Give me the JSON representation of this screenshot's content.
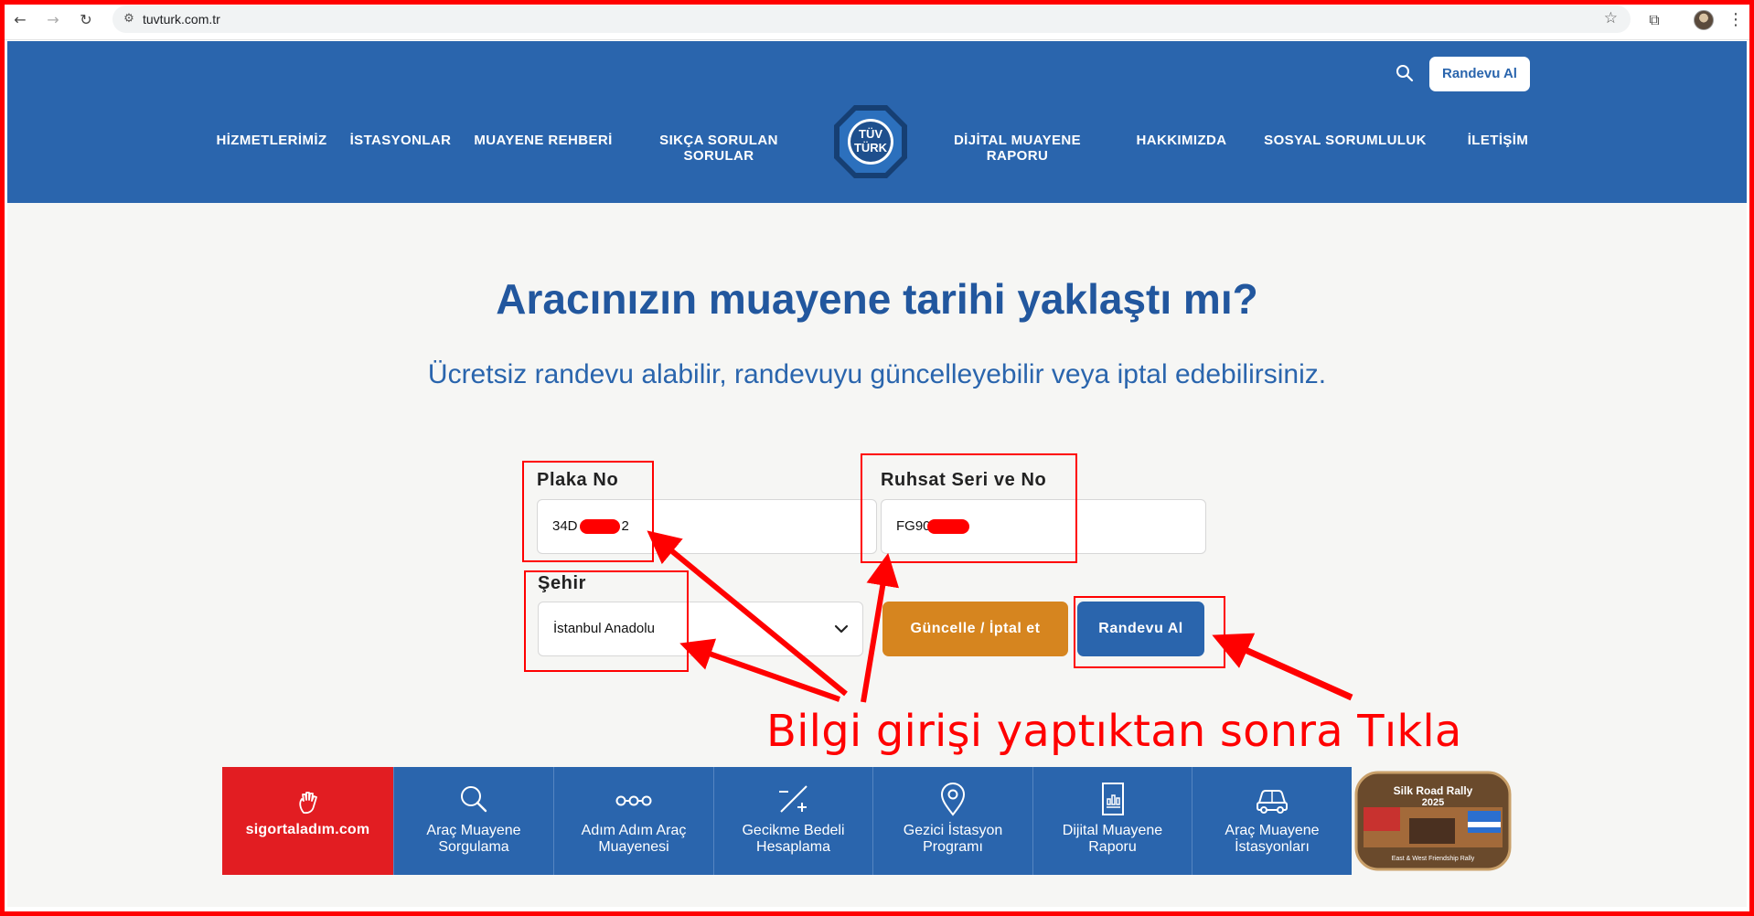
{
  "browser": {
    "url": "tuvturk.com.tr",
    "icons": [
      "back-icon",
      "forward-icon",
      "reload-icon",
      "site-settings-icon",
      "star-icon",
      "extensions-icon",
      "profile-avatar",
      "menu-icon"
    ]
  },
  "header": {
    "nav_left": [
      "HİZMETLERİMİZ",
      "İSTASYONLAR",
      "MUAYENE REHBERİ",
      "SIKÇA SORULAN SORULAR"
    ],
    "nav_right": [
      "DİJİTAL MUAYENE RAPORU",
      "HAKKIMIZDA",
      "SOSYAL SORUMLULUK",
      "İLETİŞİM"
    ],
    "logo_line1": "TÜV",
    "logo_line2": "TÜRK",
    "cta": "Randevu Al",
    "colors": {
      "primary": "#2a65ad",
      "white": "#ffffff"
    }
  },
  "hero": {
    "title": "Aracınızın muayene tarihi yaklaştı mı?",
    "subtitle": "Ücretsiz randevu alabilir, randevuyu güncelleyebilir veya iptal edebilirsiniz."
  },
  "form": {
    "plate_label": "Plaka No",
    "plate_value_start": "34D",
    "plate_value_end": "2",
    "license_label": "Ruhsat Seri ve No",
    "license_value_start": "FG90",
    "city_label": "Şehir",
    "city_value": "İstanbul Anadolu",
    "update_button": "Güncelle / İptal et",
    "book_button": "Randevu Al",
    "colors": {
      "update": "#d6851f",
      "book": "#2a65ad",
      "redaction": "#ff0000"
    }
  },
  "annotation": {
    "text": "Bilgi girişi yaptıktan sonra Tıkla",
    "color": "#ff0000"
  },
  "services": {
    "brand": "sigortaladım.com",
    "brand_color": "#e21d22",
    "tiles": [
      {
        "icon": "search-icon",
        "label1": "Araç Muayene",
        "label2": "Sorgulama"
      },
      {
        "icon": "steps-icon",
        "label1": "Adım Adım Araç",
        "label2": "Muayenesi"
      },
      {
        "icon": "late-fee-icon",
        "label1": "Gecikme Bedeli",
        "label2": "Hesaplama"
      },
      {
        "icon": "location-pin-icon",
        "label1": "Gezici İstasyon",
        "label2": "Programı"
      },
      {
        "icon": "report-icon",
        "label1": "Dijital Muayene",
        "label2": "Raporu"
      },
      {
        "icon": "car-icon",
        "label1": "Araç Muayene",
        "label2": "İstasyonları"
      }
    ],
    "badge": {
      "line1": "Silk Road Rally",
      "year": "2025",
      "line2": "East & West Friendship Rally"
    }
  }
}
